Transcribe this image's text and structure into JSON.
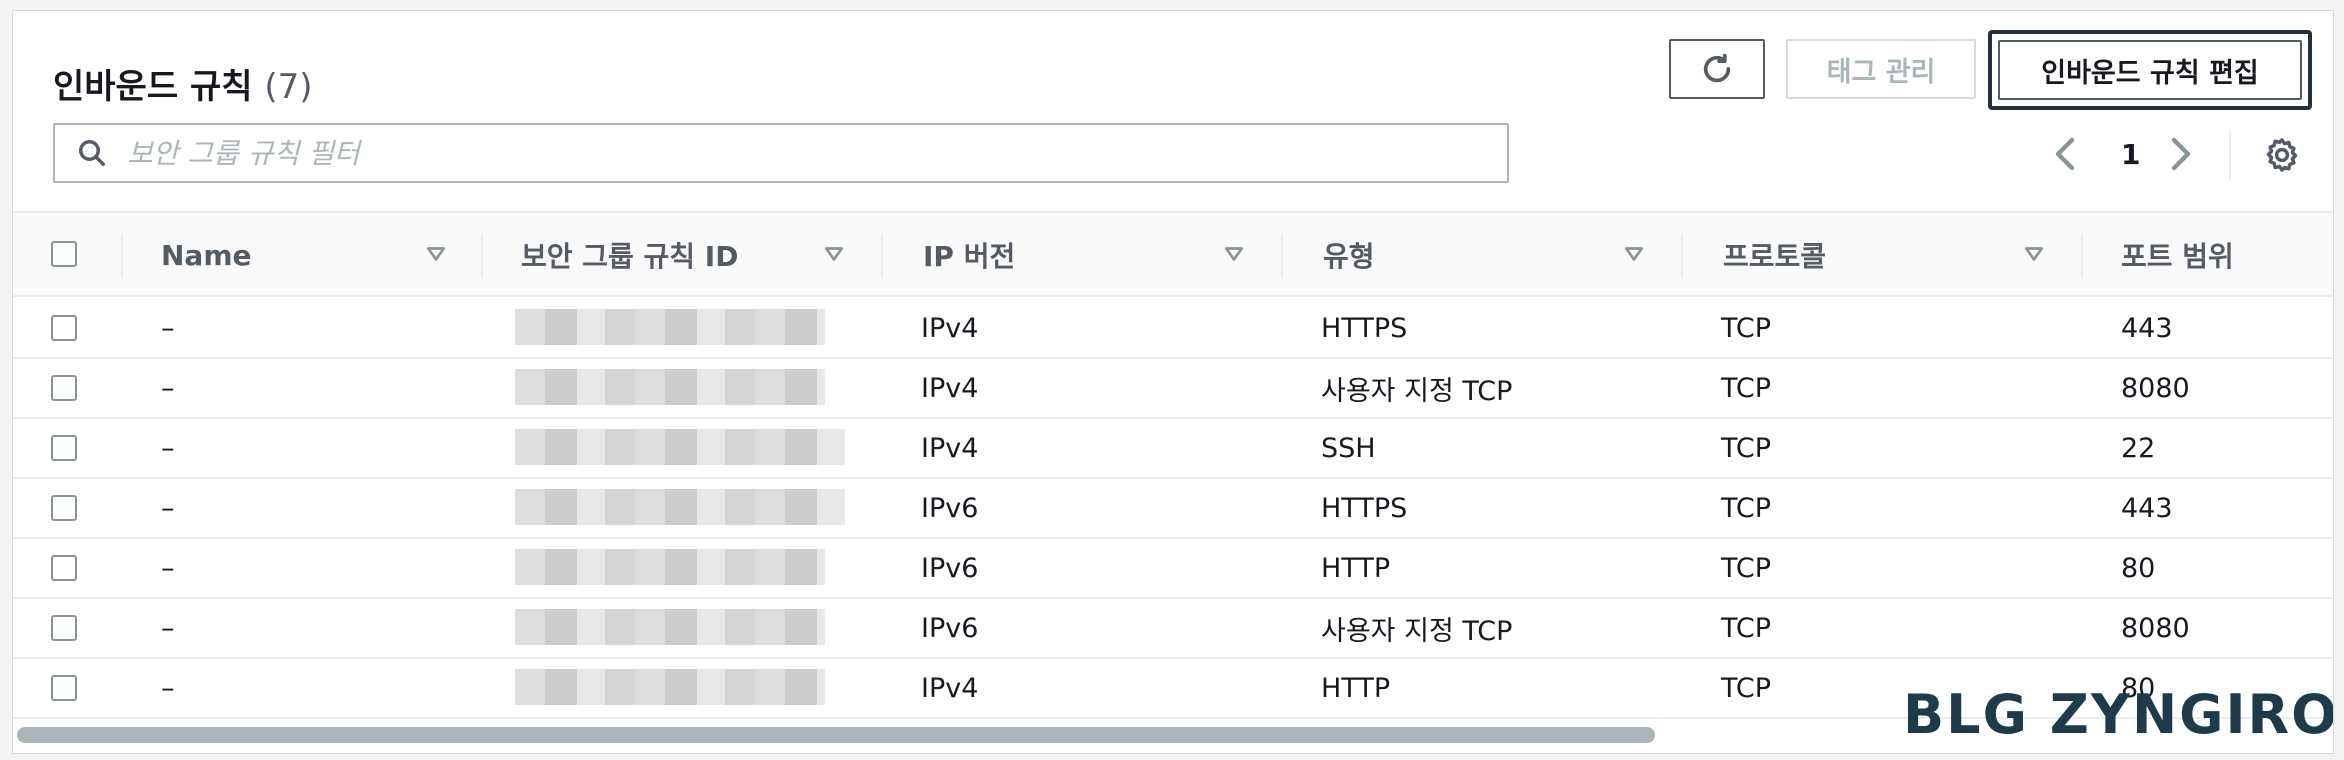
{
  "header": {
    "title": "인바운드 규칙",
    "count": "(7)",
    "tag_button": "태그 관리",
    "edit_button": "인바운드 규칙 편집"
  },
  "search": {
    "placeholder": "보안 그룹 규칙 필터"
  },
  "pagination": {
    "current_page": "1"
  },
  "columns": [
    "Name",
    "보안 그룹 규칙 ID",
    "IP 버전",
    "유형",
    "프로토콜",
    "포트 범위"
  ],
  "rows": [
    {
      "name": "–",
      "ip": "IPv4",
      "type": "HTTPS",
      "protocol": "TCP",
      "port": "443"
    },
    {
      "name": "–",
      "ip": "IPv4",
      "type": "사용자 지정 TCP",
      "protocol": "TCP",
      "port": "8080"
    },
    {
      "name": "–",
      "ip": "IPv4",
      "type": "SSH",
      "protocol": "TCP",
      "port": "22"
    },
    {
      "name": "–",
      "ip": "IPv6",
      "type": "HTTPS",
      "protocol": "TCP",
      "port": "443"
    },
    {
      "name": "–",
      "ip": "IPv6",
      "type": "HTTP",
      "protocol": "TCP",
      "port": "80"
    },
    {
      "name": "–",
      "ip": "IPv6",
      "type": "사용자 지정 TCP",
      "protocol": "TCP",
      "port": "8080"
    },
    {
      "name": "–",
      "ip": "IPv4",
      "type": "HTTP",
      "protocol": "TCP",
      "port": "80"
    }
  ],
  "watermark": "BLG ZYNGIROK",
  "icons": {
    "refresh": "refresh-icon",
    "search": "search-icon",
    "prev": "chevron-left-icon",
    "next": "chevron-right-icon",
    "settings": "gear-icon",
    "sort": "sort-caret-icon"
  },
  "colors": {
    "primary_text": "#16191f",
    "secondary_text": "#545b64",
    "border": "#aab7b8",
    "disabled": "#aab7b8"
  }
}
